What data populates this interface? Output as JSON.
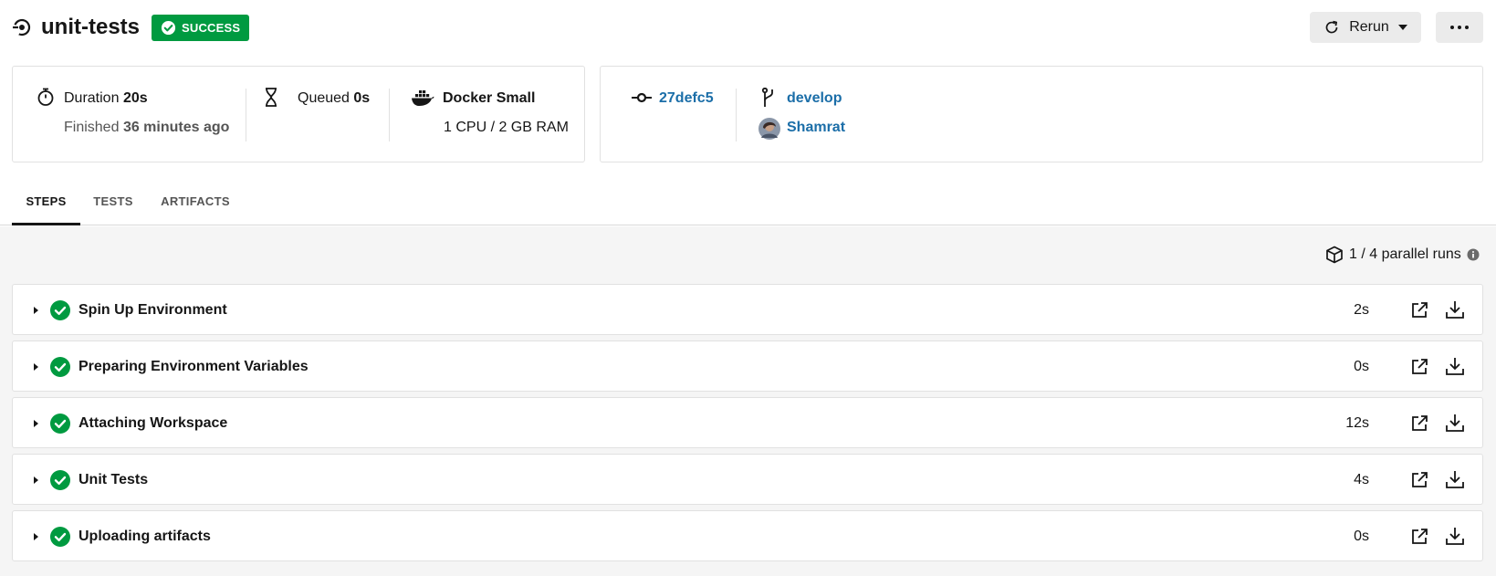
{
  "job": {
    "title": "unit-tests",
    "status": "SUCCESS",
    "status_color": "#009a40"
  },
  "actions": {
    "rerun_label": "Rerun",
    "more_icon": "ellipsis-icon"
  },
  "summary": {
    "duration_label": "Duration",
    "duration_value": "20s",
    "finished_label": "Finished",
    "finished_value": "36 minutes ago",
    "queued_label": "Queued",
    "queued_value": "0s",
    "executor_name": "Docker Small",
    "executor_resources": "1 CPU / 2 GB RAM"
  },
  "vcs": {
    "commit": "27defc5",
    "branch": "develop",
    "user": "Shamrat",
    "link_color": "#1b6ea8"
  },
  "tabs": [
    {
      "label": "STEPS",
      "active": true
    },
    {
      "label": "TESTS",
      "active": false
    },
    {
      "label": "ARTIFACTS",
      "active": false
    }
  ],
  "parallel_runs": "1 / 4 parallel runs",
  "steps": [
    {
      "name": "Spin Up Environment",
      "duration": "2s",
      "status": "success"
    },
    {
      "name": "Preparing Environment Variables",
      "duration": "0s",
      "status": "success"
    },
    {
      "name": "Attaching Workspace",
      "duration": "12s",
      "status": "success"
    },
    {
      "name": "Unit Tests",
      "duration": "4s",
      "status": "success"
    },
    {
      "name": "Uploading artifacts",
      "duration": "0s",
      "status": "success"
    }
  ]
}
